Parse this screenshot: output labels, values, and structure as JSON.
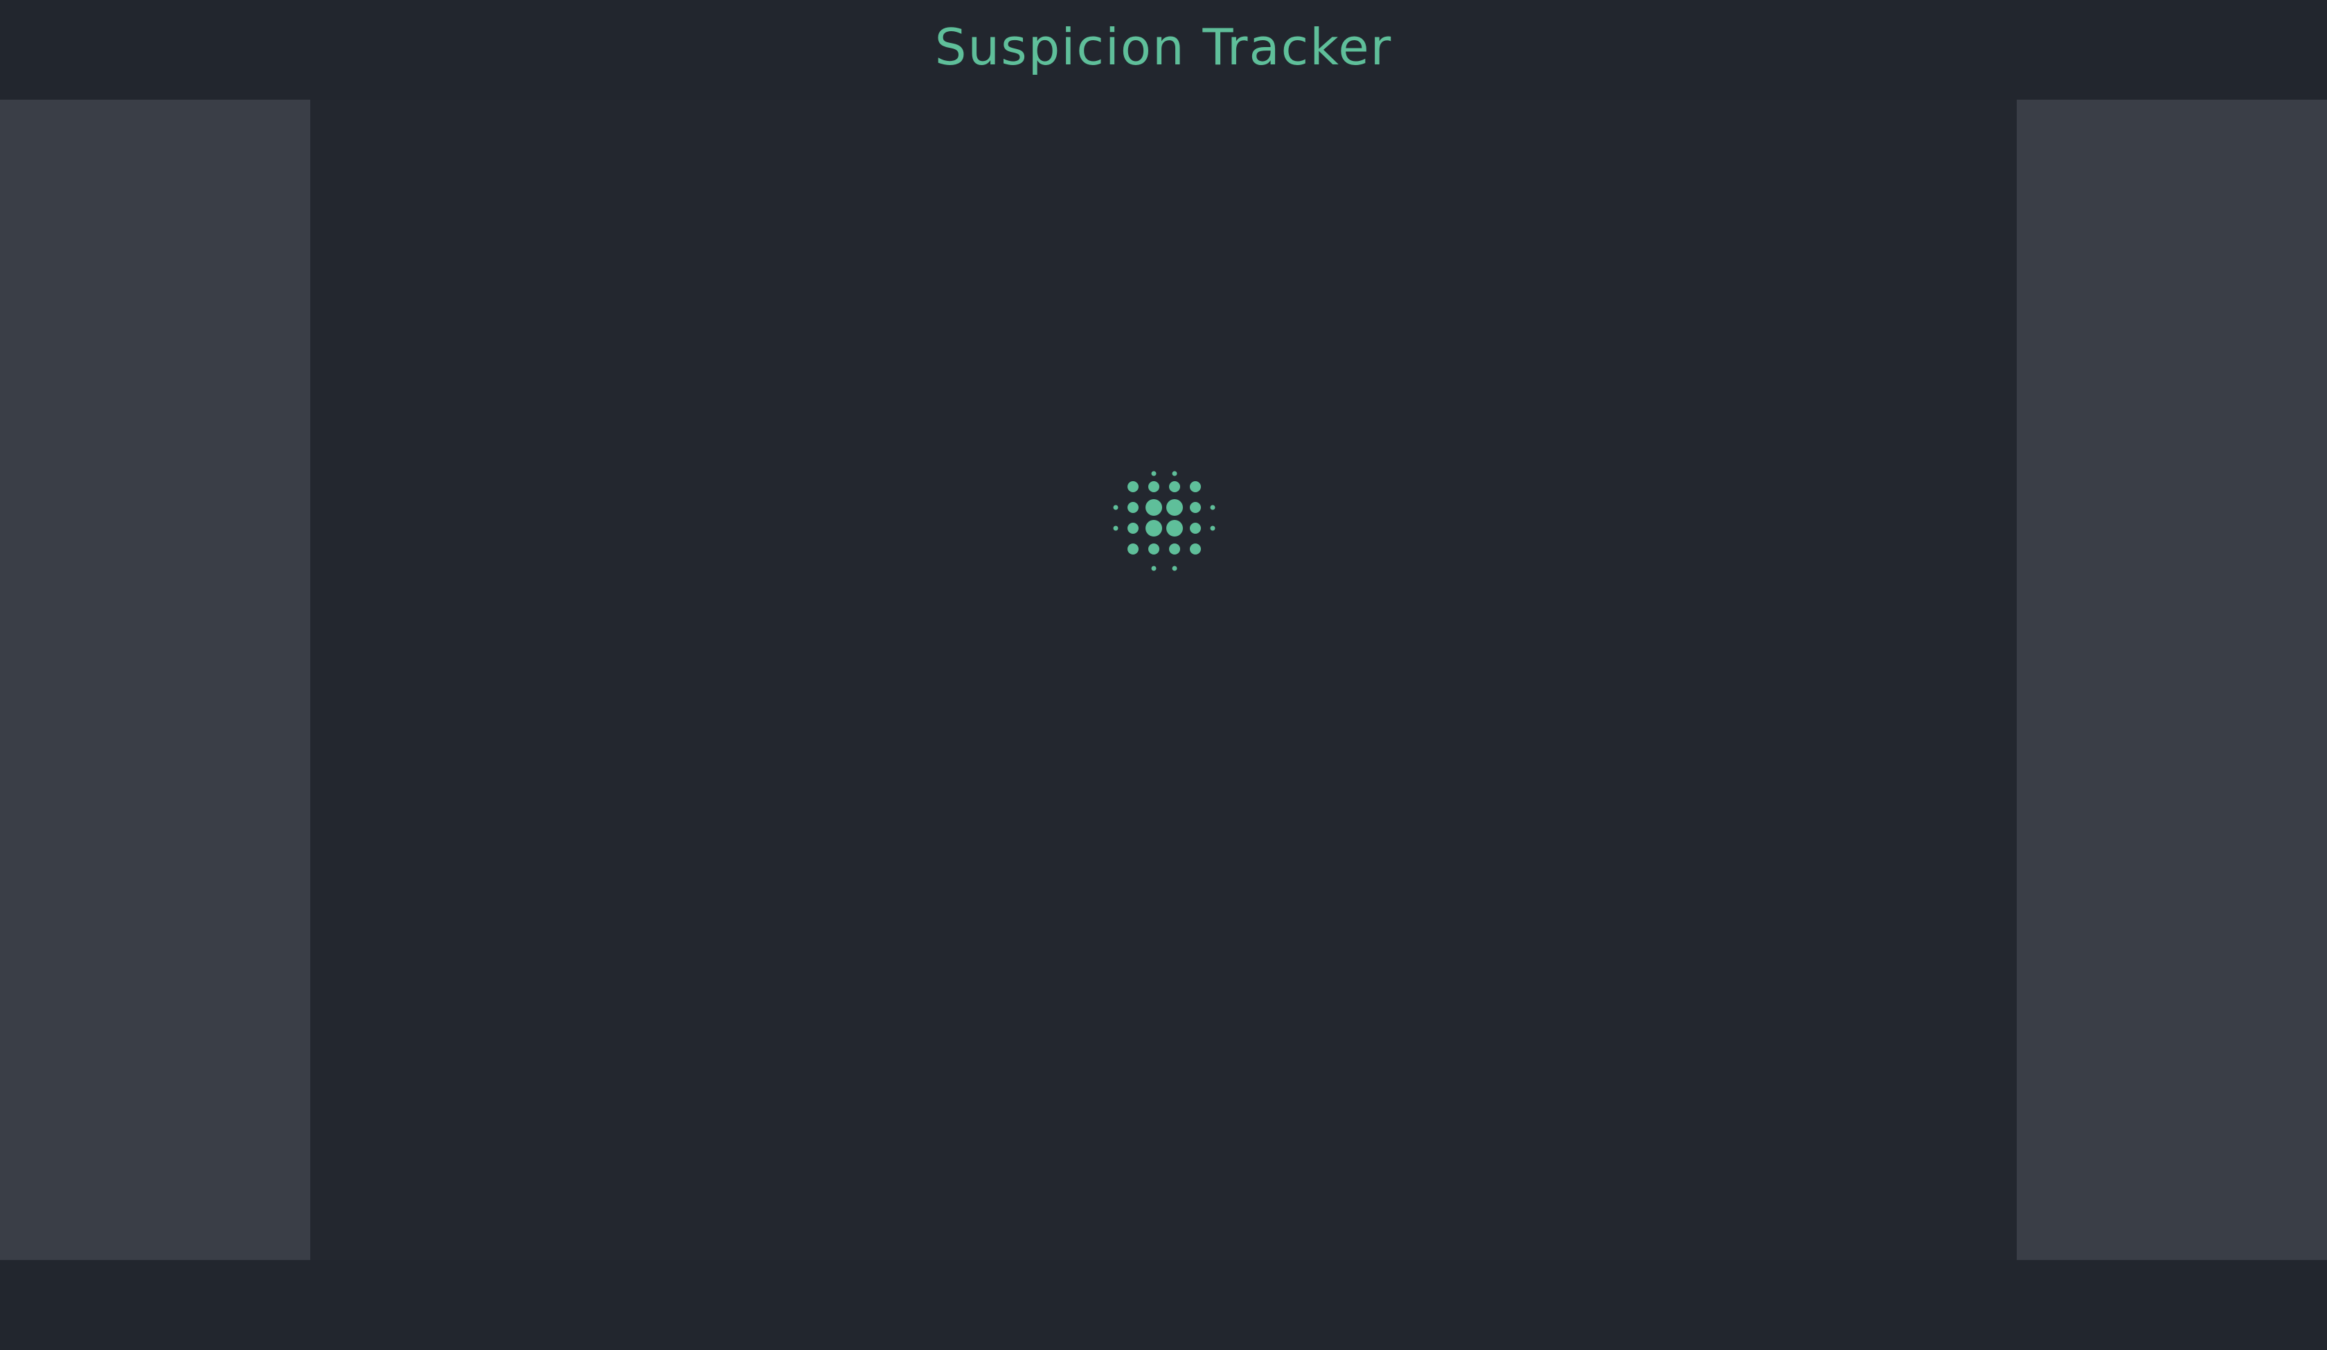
{
  "app": {
    "title": "Suspicion Tracker"
  },
  "loading_indicator": {
    "icon": "loading-spinner-icon",
    "color": "#5fbf9a"
  },
  "colors": {
    "background": "#23272f",
    "side_panels": "#3a3e47",
    "accent": "#5fbf9a"
  }
}
